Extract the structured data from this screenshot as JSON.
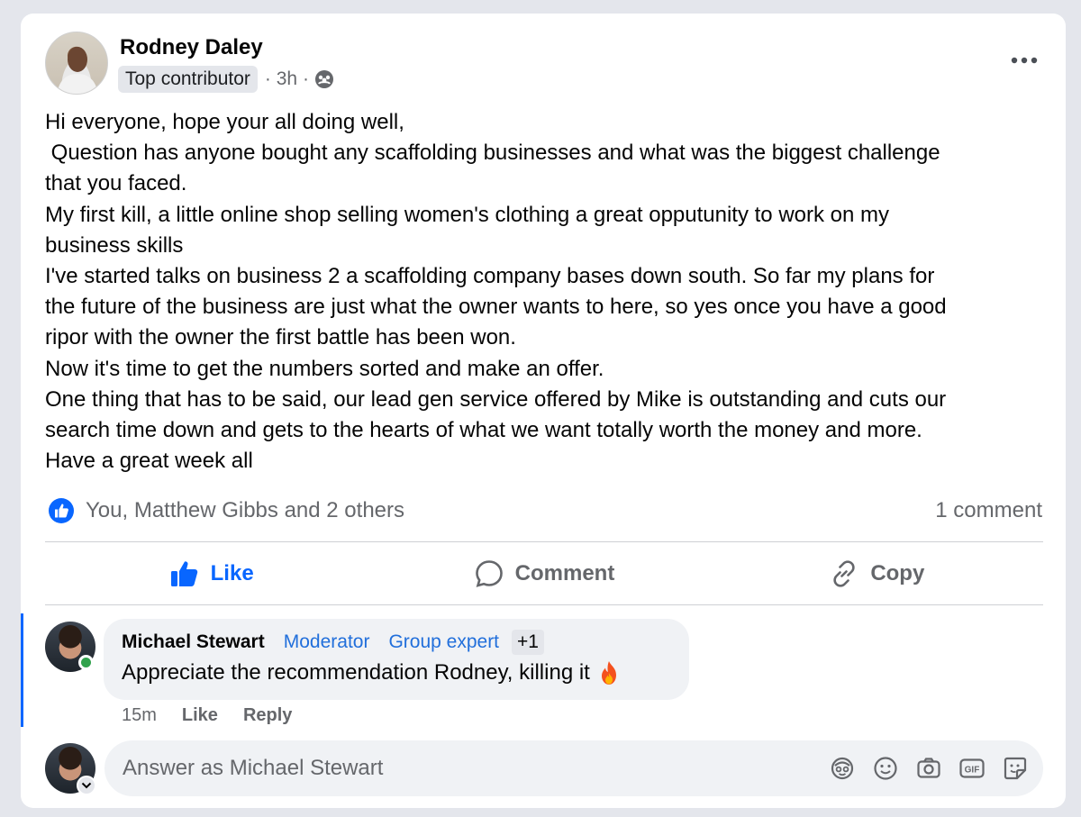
{
  "post": {
    "author": {
      "name": "Rodney Daley",
      "badge": "Top contributor",
      "meta": "· 3h ·",
      "privacy_icon": "group-members-icon"
    },
    "more_icon": "ellipsis-icon",
    "lines": [
      "Hi everyone, hope your all doing well,",
      " Question has anyone bought any scaffolding businesses and what was the biggest challenge",
      "that you faced.",
      "My first kill, a little online shop selling women's clothing a great opputunity to work on my",
      "business skills",
      "I've started talks on business 2 a scaffolding company bases down south. So far my plans for",
      "the future of the business are just what the owner wants to here, so yes once you have a good",
      "ripor with the owner the first battle has been won.",
      "Now it's time to get the numbers sorted and make an offer.",
      "One thing that has to be said, our lead gen service offered by Mike is outstanding and cuts our",
      "search time down and gets to the hearts of what we want totally worth the money and more.",
      "Have a great week all"
    ],
    "reactions": {
      "summary": "You, Matthew Gibbs and 2 others",
      "icon": "like-reaction-icon",
      "comment_count": "1 comment"
    },
    "actions": {
      "like": "Like",
      "comment": "Comment",
      "copy": "Copy"
    }
  },
  "comment": {
    "name": "Michael Stewart",
    "badge_moderator": "Moderator",
    "badge_expert": "Group expert",
    "badge_more": "+1",
    "text": "Appreciate the recommendation Rodney, killing it",
    "emoji_icon": "fire-icon",
    "time": "15m",
    "like_label": "Like",
    "reply_label": "Reply",
    "online": true
  },
  "composer": {
    "placeholder": "Answer as Michael Stewart",
    "icons": [
      "avatar-sticker-icon",
      "emoji-icon",
      "camera-icon",
      "gif-icon",
      "sticker-icon"
    ]
  },
  "colors": {
    "accent": "#0866ff",
    "background": "#e4e6ec",
    "secondary_text": "#65676b",
    "online": "#31a24c"
  }
}
